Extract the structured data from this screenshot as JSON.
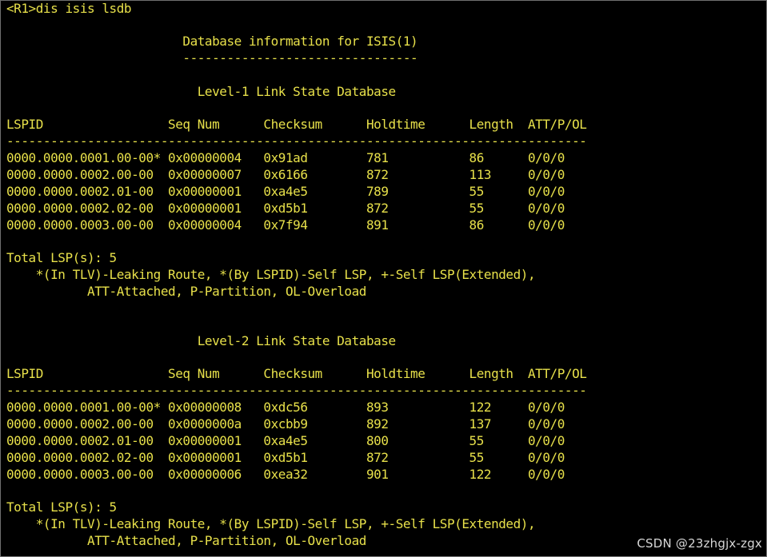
{
  "terminal": {
    "lines": [
      "<R1>dis isis lsdb",
      "",
      "                        Database information for ISIS(1)",
      "                        --------------------------------",
      "",
      "                          Level-1 Link State Database",
      "",
      "LSPID                 Seq Num      Checksum      Holdtime      Length  ATT/P/OL",
      "-------------------------------------------------------------------------------",
      "0000.0000.0001.00-00* 0x00000004   0x91ad        781           86      0/0/0",
      "0000.0000.0002.00-00  0x00000007   0x6166        872           113     0/0/0",
      "0000.0000.0002.01-00  0x00000001   0xa4e5        789           55      0/0/0",
      "0000.0000.0002.02-00  0x00000001   0xd5b1        872           55      0/0/0",
      "0000.0000.0003.00-00  0x00000004   0x7f94        891           86      0/0/0",
      "",
      "Total LSP(s): 5",
      "    *(In TLV)-Leaking Route, *(By LSPID)-Self LSP, +-Self LSP(Extended),",
      "           ATT-Attached, P-Partition, OL-Overload",
      "",
      "",
      "                          Level-2 Link State Database",
      "",
      "LSPID                 Seq Num      Checksum      Holdtime      Length  ATT/P/OL",
      "-------------------------------------------------------------------------------",
      "0000.0000.0001.00-00* 0x00000008   0xdc56        893           122     0/0/0",
      "0000.0000.0002.00-00  0x0000000a   0xcbb9        892           137     0/0/0",
      "0000.0000.0002.01-00  0x00000001   0xa4e5        800           55      0/0/0",
      "0000.0000.0002.02-00  0x00000001   0xd5b1        872           55      0/0/0",
      "0000.0000.0003.00-00  0x00000006   0xea32        901           122     0/0/0",
      "",
      "Total LSP(s): 5",
      "    *(In TLV)-Leaking Route, *(By LSPID)-Self LSP, +-Self LSP(Extended),",
      "           ATT-Attached, P-Partition, OL-Overload"
    ]
  },
  "watermark": "CSDN @23zhgjx-zgx",
  "colors": {
    "background": "#000000",
    "text": "#e7e04a",
    "watermark": "#d7d7d7"
  }
}
